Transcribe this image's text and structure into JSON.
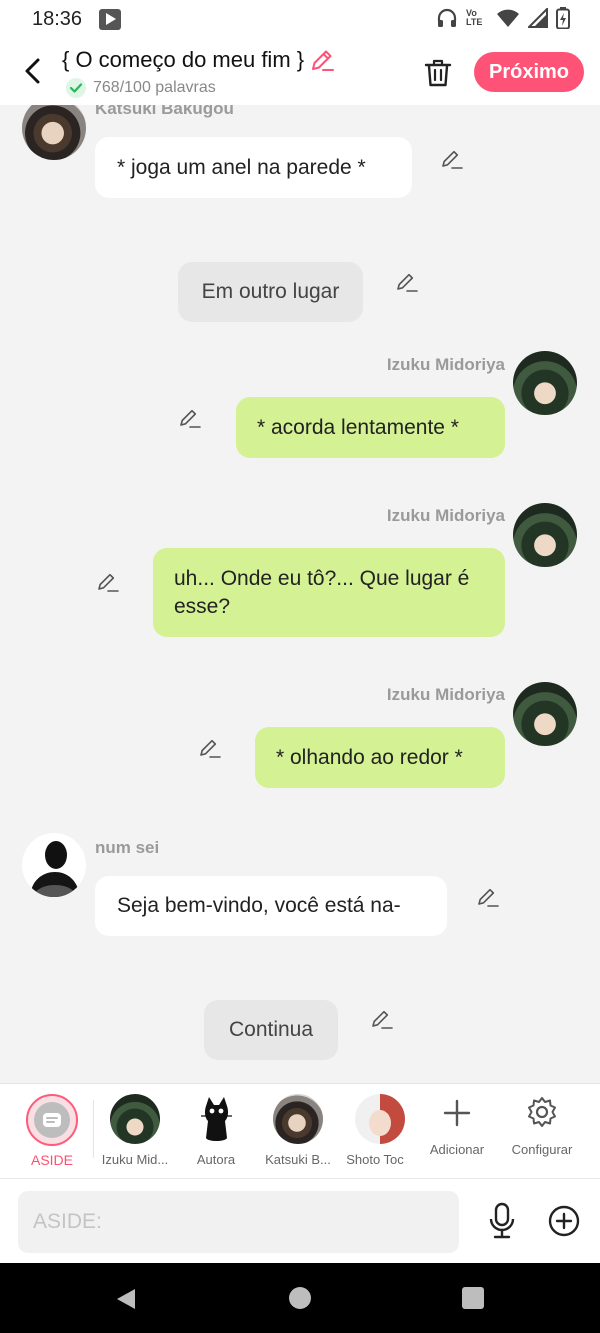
{
  "status_bar": {
    "time": "18:36",
    "network_label": "Vo LTE"
  },
  "header": {
    "title": "{ O começo do meu fim }",
    "word_count": "768/100 palavras",
    "next_button": "Próximo"
  },
  "messages": [
    {
      "type": "left",
      "name": "Katsuki Bakugou",
      "text": "* joga um anel na parede *"
    },
    {
      "type": "center",
      "text": "Em outro lugar"
    },
    {
      "type": "right",
      "name": "Izuku Midoriya",
      "text": "* acorda lentamente *"
    },
    {
      "type": "right",
      "name": "Izuku Midoriya",
      "text": "uh... Onde eu tô?... Que lugar é esse?"
    },
    {
      "type": "right",
      "name": "Izuku Midoriya",
      "text": "* olhando ao redor *"
    },
    {
      "type": "left",
      "name": "num sei",
      "text": "Seja bem-vindo, você está na-"
    },
    {
      "type": "center",
      "text": "Continua"
    }
  ],
  "character_bar": {
    "aside_label": "ASIDE",
    "characters": [
      {
        "label": "Izuku Mid..."
      },
      {
        "label": "Autora"
      },
      {
        "label": "Katsuki B..."
      },
      {
        "label": "Shoto Toc"
      }
    ],
    "add_label": "Adicionar",
    "settings_label": "Configurar"
  },
  "input": {
    "placeholder": "ASIDE:"
  },
  "colors": {
    "accent": "#ff5277",
    "right_bubble": "#d4f193",
    "left_bubble": "#ffffff",
    "center_bubble": "#e7e7e7",
    "check_green": "#2bb55a"
  }
}
